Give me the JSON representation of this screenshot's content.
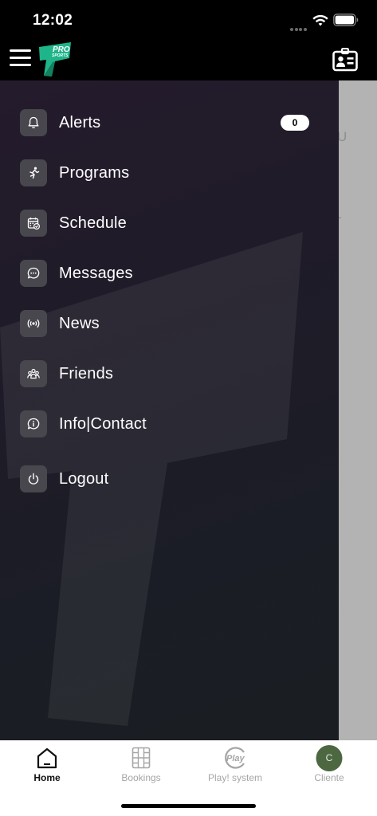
{
  "status_bar": {
    "time": "12:02"
  },
  "header": {
    "menu_icon": "hamburger-icon",
    "logo_text_top": "PRO",
    "logo_text_bottom": "SPORTS",
    "logo_color": "#1fb58a",
    "right_icon": "id-card-icon"
  },
  "drawer": {
    "items": [
      {
        "label": "Alerts",
        "icon": "bell-icon",
        "badge": "0"
      },
      {
        "label": "Programs",
        "icon": "running-figure-icon"
      },
      {
        "label": "Schedule",
        "icon": "calendar-check-icon"
      },
      {
        "label": "Messages",
        "icon": "chat-bubble-icon"
      },
      {
        "label": "News",
        "icon": "broadcast-icon"
      },
      {
        "label": "Friends",
        "icon": "group-icon"
      },
      {
        "label": "Info|Contact",
        "icon": "info-bubble-icon"
      },
      {
        "label": "Logout",
        "icon": "power-icon"
      }
    ]
  },
  "background_screen": {
    "fragment_1": "U",
    "fragment_2": "-"
  },
  "tab_bar": {
    "tabs": [
      {
        "label": "Home",
        "icon": "home-icon",
        "active": true
      },
      {
        "label": "Bookings",
        "icon": "bookings-icon"
      },
      {
        "label": "Play! system",
        "icon": "play-logo-icon"
      },
      {
        "label": "Cliente",
        "avatar_letter": "C"
      }
    ]
  },
  "colors": {
    "drawer_bg": "#221c2b",
    "icon_box": "#48474e",
    "avatar_bg": "#4d6841",
    "accent": "#1fb58a"
  }
}
